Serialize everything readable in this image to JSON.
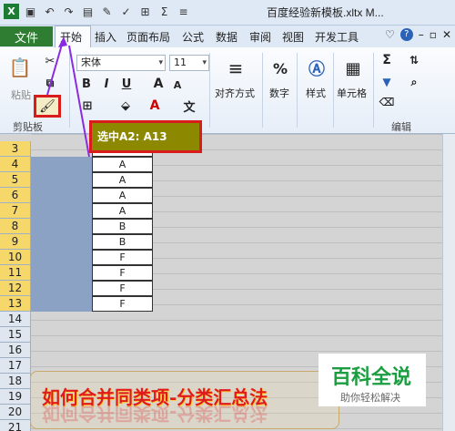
{
  "window": {
    "title": "百度经验新模板.xltx M...",
    "app_icon": "excel-icon",
    "quick_access": [
      "save-icon",
      "undo-icon",
      "redo-icon",
      "print-preview-icon",
      "format-painter-icon",
      "check-icon",
      "borders-icon",
      "autosum-icon",
      "align-icon"
    ]
  },
  "tabs": {
    "file": "文件",
    "items": [
      "开始",
      "插入",
      "页面布局",
      "公式",
      "数据",
      "审阅",
      "视图",
      "开发工具"
    ]
  },
  "ribbon": {
    "clipboard_label": "剪贴板",
    "paste_label": "粘贴",
    "font_name": "宋体",
    "font_size": "11",
    "bold": "B",
    "italic": "I",
    "underline": "U",
    "grow_font": "A",
    "shrink_font": "A",
    "font_color": "A",
    "wen": "文",
    "align_label": "对齐方式",
    "number_label": "数字",
    "number_symbol": "%",
    "style_label": "样式",
    "cell_label": "单元格",
    "edit_label": "编辑",
    "sigma": "Σ"
  },
  "callout": {
    "text": "选中A2: A13"
  },
  "grid": {
    "row_numbers": [
      "3",
      "4",
      "5",
      "6",
      "7",
      "8",
      "9",
      "10",
      "11",
      "12",
      "13",
      "14",
      "15",
      "16",
      "17",
      "18",
      "19",
      "20",
      "21"
    ],
    "selected_rows": [
      "3",
      "4",
      "5",
      "6",
      "7",
      "8",
      "9",
      "10",
      "11",
      "12",
      "13"
    ],
    "col_b_values": [
      "B",
      "A",
      "A",
      "A",
      "A",
      "B",
      "B",
      "F",
      "F",
      "F",
      "F"
    ]
  },
  "caption": {
    "text": "如何合并同类项-分类汇总法"
  },
  "brand": {
    "title": "百科全说",
    "subtitle": "助你轻松解决"
  },
  "colors": {
    "file_tab": "#2e7d32",
    "selection": "#8ba2c4",
    "callout_bg": "#8c8800",
    "highlight_border": "#d91b1b",
    "arrow": "#8a2be2"
  }
}
